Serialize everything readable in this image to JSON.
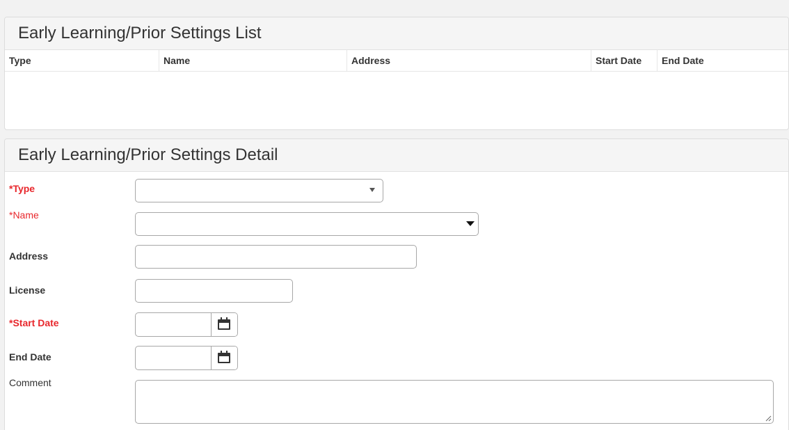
{
  "list_panel": {
    "title": "Early Learning/Prior Settings List",
    "columns": [
      "Type",
      "Name",
      "Address",
      "Start Date",
      "End Date"
    ],
    "rows": []
  },
  "detail_panel": {
    "title": "Early Learning/Prior Settings Detail",
    "fields": {
      "type": {
        "label": "*Type",
        "value": ""
      },
      "name": {
        "label": "*Name",
        "value": ""
      },
      "address": {
        "label": "Address",
        "value": ""
      },
      "license": {
        "label": "License",
        "value": ""
      },
      "start_date": {
        "label": "*Start Date",
        "value": ""
      },
      "end_date": {
        "label": "End Date",
        "value": ""
      },
      "comment": {
        "label": "Comment",
        "value": ""
      }
    }
  },
  "icons": {
    "select_arrow": "chevron-down-icon",
    "calendar": "calendar-icon",
    "resize": "resize-grip-icon"
  },
  "colors": {
    "required_label": "#e8272c",
    "page_background": "#f2f2f2",
    "panel_header": "#f5f5f5",
    "calendar_icon": "#333333"
  }
}
